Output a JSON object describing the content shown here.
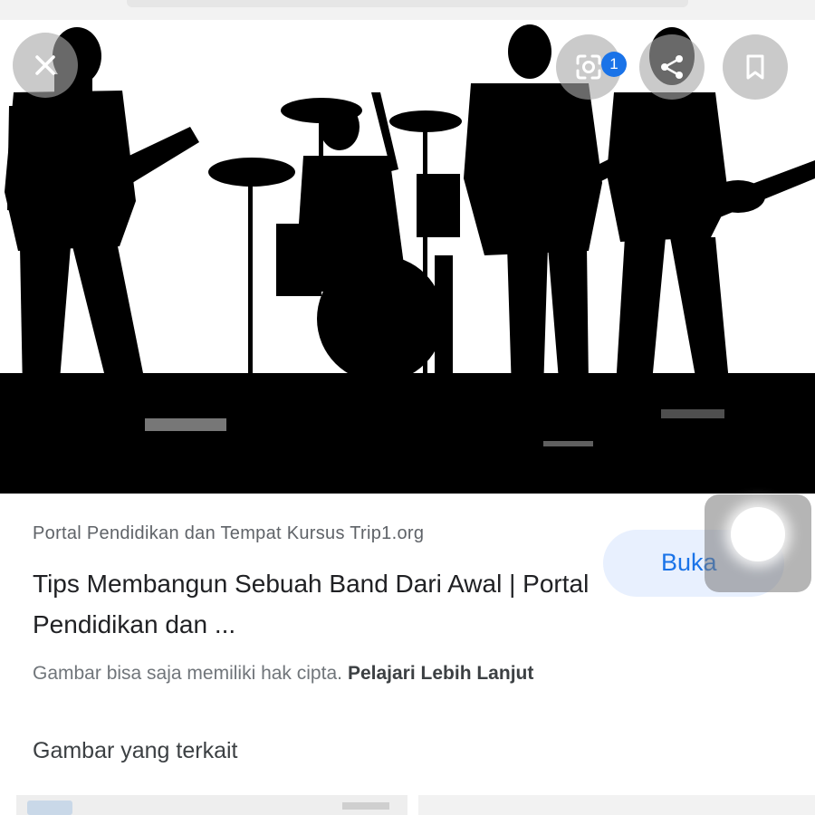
{
  "viewer": {
    "close_icon": "close-icon",
    "lens_icon": "google-lens-icon",
    "lens_badge": "1",
    "share_icon": "share-icon",
    "bookmark_icon": "bookmark-icon"
  },
  "result": {
    "source": "Portal Pendidikan dan Tempat Kursus Trip1.org",
    "title": "Tips Membangun Sebuah Band Dari Awal | Portal Pendidikan dan ...",
    "open_label": "Buka",
    "copyright_notice": "Gambar bisa saja memiliki hak cipta.",
    "learn_more": "Pelajari Lebih Lanjut"
  },
  "related": {
    "heading": "Gambar yang terkait"
  },
  "colors": {
    "accent": "#1a73e8",
    "open_button_bg": "#e8f0fe",
    "text_primary": "#202124",
    "text_secondary": "#5f6368"
  }
}
